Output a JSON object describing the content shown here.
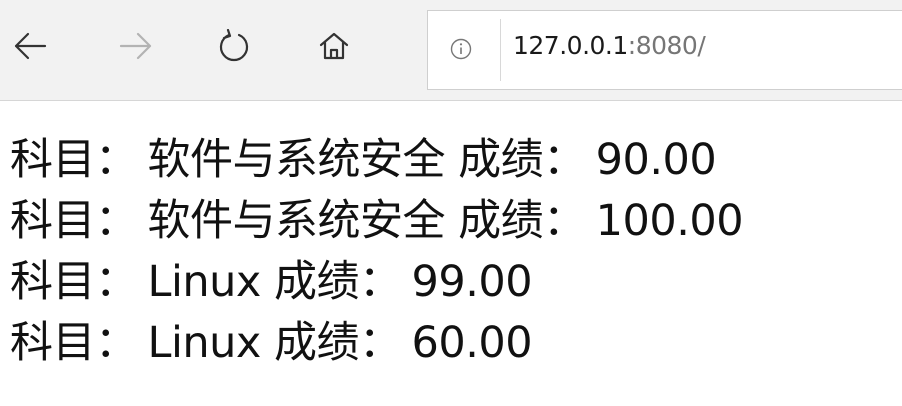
{
  "browser": {
    "back_icon": "arrow-left-icon",
    "forward_icon": "arrow-right-icon",
    "reload_icon": "reload-icon",
    "home_icon": "home-icon",
    "site_info_icon": "info-icon",
    "url_host": "127.0.0.1",
    "url_port": ":8080/"
  },
  "page": {
    "rows": [
      {
        "subject_label": "科目：",
        "subject": "软件与系统安全",
        "score_label": "成绩：",
        "score": "90.00"
      },
      {
        "subject_label": "科目：",
        "subject": "软件与系统安全",
        "score_label": "成绩：",
        "score": "100.00"
      },
      {
        "subject_label": "科目：",
        "subject": "Linux",
        "score_label": "成绩：",
        "score": "99.00"
      },
      {
        "subject_label": "科目：",
        "subject": "Linux",
        "score_label": "成绩：",
        "score": "60.00"
      }
    ]
  }
}
